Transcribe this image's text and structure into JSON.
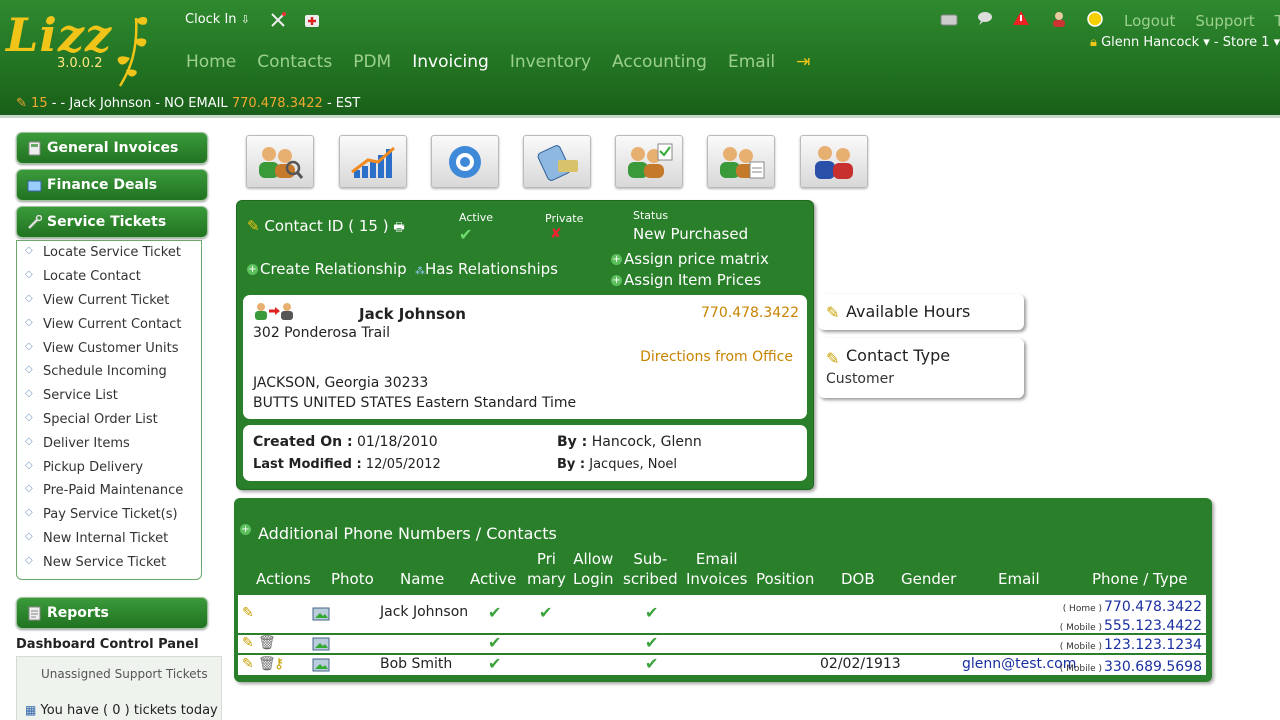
{
  "app": {
    "logo": "Lizz",
    "version": "3.0.0.2"
  },
  "header": {
    "clock_in": "Clock In",
    "nav": [
      "Home",
      "Contacts",
      "PDM",
      "Invoicing",
      "Inventory",
      "Accounting",
      "Email"
    ],
    "active_nav": "Invoicing",
    "links": [
      "Logout",
      "Support",
      "Tr"
    ],
    "user": "Glenn Hancock",
    "store": "Store 1",
    "user_separator": " - ",
    "contact_line": {
      "id": "15",
      "sep1": "- - Jack Johnson - NO EMAIL",
      "phone": "770.478.3422",
      "tz": "- EST"
    }
  },
  "sidebar": {
    "general_invoices": "General Invoices",
    "finance_deals": "Finance Deals",
    "service_tickets": "Service Tickets",
    "menu": [
      "Locate Service Ticket",
      "Locate Contact",
      "View Current Ticket",
      "View Current Contact",
      "View Customer Units",
      "Schedule Incoming",
      "Service List",
      "Special Order List",
      "Deliver Items",
      "Pickup Delivery",
      "Pre-Paid Maintenance",
      "Pay Service Ticket(s)",
      "New Internal Ticket",
      "New Service Ticket"
    ],
    "reports": "Reports",
    "dashboard_title": "Dashboard Control Panel",
    "unassigned": "Unassigned Support Tickets",
    "tickets_today": "You have ( 0 ) tickets today"
  },
  "contact": {
    "id_label": "Contact ID ( 15 )",
    "active_label": "Active",
    "private_label": "Private",
    "status_label": "Status",
    "status_value": "New Purchased",
    "create_relationship": "Create Relationship",
    "has_relationships": "Has Relationships",
    "assign_price_matrix": "Assign price matrix",
    "assign_item_prices": "Assign Item Prices",
    "name": "Jack Johnson",
    "phone": "770.478.3422",
    "address1": "302 Ponderosa Trail",
    "directions": "Directions from Office",
    "city_line": "JACKSON, Georgia 30233",
    "county_line": "BUTTS UNITED STATES Eastern Standard Time",
    "created_on_label": "Created On :",
    "created_on": "01/18/2010",
    "created_by_label": "By :",
    "created_by": "Hancock, Glenn",
    "modified_label": "Last Modified :",
    "modified": "12/05/2012",
    "modified_by_label": "By :",
    "modified_by": "Jacques, Noel"
  },
  "side_cards": {
    "available_hours": "Available Hours",
    "contact_type_label": "Contact Type",
    "contact_type_value": "Customer"
  },
  "phones": {
    "title": "Additional Phone Numbers / Contacts",
    "headers": [
      "Actions",
      "Photo",
      "Name",
      "Active",
      "Pri mary",
      "Allow Login",
      "Sub- scribed",
      "Email Invoices",
      "Position",
      "DOB",
      "Gender",
      "Email",
      "Phone / Type"
    ],
    "header_lines": {
      "primary": [
        "Pri",
        "mary"
      ],
      "allow_login": [
        "Allow",
        "Login"
      ],
      "subscribed": [
        "Sub-",
        "scribed"
      ],
      "email_invoices": [
        "Email",
        "Invoices"
      ]
    },
    "rows": [
      {
        "name": "Jack Johnson",
        "dob": "",
        "email": "",
        "phones": [
          {
            "type": "( Home )",
            "num": "770.478.3422"
          },
          {
            "type": "( Mobile )",
            "num": "555.123.4422"
          }
        ]
      },
      {
        "name": "",
        "dob": "",
        "email": "",
        "phones": [
          {
            "type": "( Mobile )",
            "num": "123.123.1234"
          }
        ]
      },
      {
        "name": "Bob Smith",
        "dob": "02/02/1913",
        "email": "glenn@test.com",
        "phones": [
          {
            "type": "( Mobile )",
            "num": "330.689.5698"
          }
        ]
      }
    ]
  },
  "colors": {
    "header_green": "#2a7f2a",
    "nav_inactive": "#9bd08e",
    "orange": "#c88400",
    "link_blue": "#1a2fa0"
  }
}
